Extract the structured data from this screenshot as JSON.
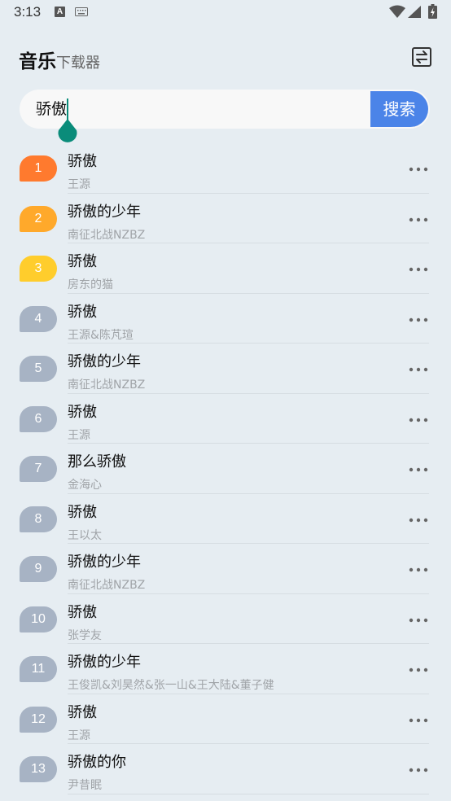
{
  "status_bar": {
    "time": "3:13",
    "a_icon_letter": "A"
  },
  "header": {
    "title_main": "音乐",
    "title_sub": "下载器",
    "toggle_icon": "swap-icon"
  },
  "search": {
    "query": "骄傲",
    "button_label": "搜索"
  },
  "colors": {
    "rank1": "#ff7a2e",
    "rank2": "#ffa92b",
    "rank3": "#ffcd2c",
    "rank_default": "#a7b3c4",
    "search_button": "#4b84e8",
    "caret": "#0a8c7a"
  },
  "songs": [
    {
      "rank": "1",
      "title": "骄傲",
      "artist": "王源"
    },
    {
      "rank": "2",
      "title": "骄傲的少年",
      "artist": "南征北战NZBZ"
    },
    {
      "rank": "3",
      "title": "骄傲",
      "artist": "房东的猫"
    },
    {
      "rank": "4",
      "title": "骄傲",
      "artist": "王源&陈芃瑄"
    },
    {
      "rank": "5",
      "title": "骄傲的少年",
      "artist": "南征北战NZBZ"
    },
    {
      "rank": "6",
      "title": "骄傲",
      "artist": "王源"
    },
    {
      "rank": "7",
      "title": "那么骄傲",
      "artist": "金海心"
    },
    {
      "rank": "8",
      "title": "骄傲",
      "artist": "王以太"
    },
    {
      "rank": "9",
      "title": "骄傲的少年",
      "artist": "南征北战NZBZ"
    },
    {
      "rank": "10",
      "title": "骄傲",
      "artist": "张学友"
    },
    {
      "rank": "11",
      "title": "骄傲的少年",
      "artist": "王俊凯&刘昊然&张一山&王大陆&董子健"
    },
    {
      "rank": "12",
      "title": "骄傲",
      "artist": "王源"
    },
    {
      "rank": "13",
      "title": "骄傲的你",
      "artist": "尹昔眠"
    }
  ]
}
